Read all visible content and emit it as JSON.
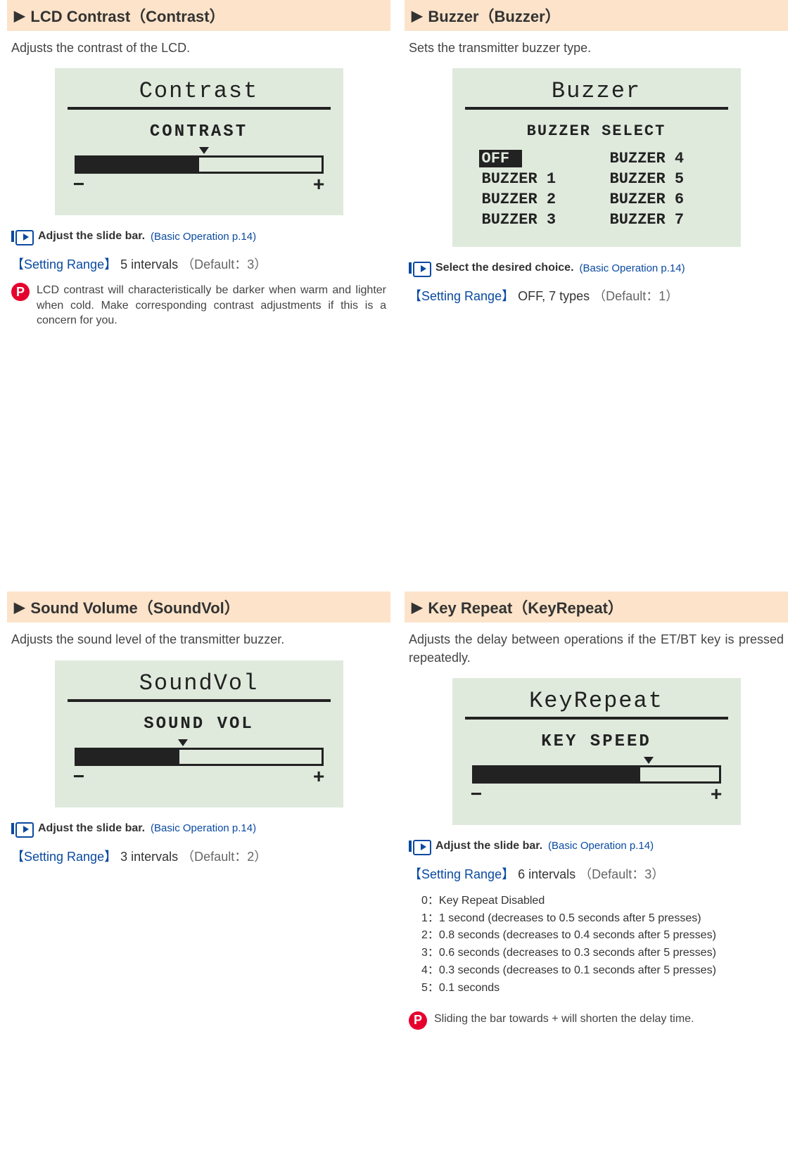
{
  "lcd": {
    "header": "LCD Contrast（Contrast）",
    "desc": "Adjusts the contrast of the LCD.",
    "screen_title": "Contrast",
    "screen_label": "CONTRAST",
    "minus": "−",
    "plus": "+",
    "fill_percent": 50,
    "marker_percent": 52,
    "hint": "Adjust the slide bar.",
    "hint_link": "(Basic Operation p.14)",
    "range_label": "【Setting Range】",
    "range_val": "5 intervals",
    "range_default": "（Default：3）",
    "note": "LCD contrast will characteristically be darker when warm and lighter when cold. Make corresponding contrast adjustments if this is a concern for you."
  },
  "buzzer": {
    "header": "Buzzer（Buzzer）",
    "desc": "Sets the transmitter buzzer type.",
    "screen_title": "Buzzer",
    "sub": "BUZZER SELECT",
    "items": {
      "off": "OFF",
      "b1": "BUZZER 1",
      "b2": "BUZZER 2",
      "b3": "BUZZER 3",
      "b4": "BUZZER 4",
      "b5": "BUZZER 5",
      "b6": "BUZZER 6",
      "b7": "BUZZER 7"
    },
    "hint": "Select the desired choice.",
    "hint_link": "(Basic Operation p.14)",
    "range_label": "【Setting Range】",
    "range_val": "OFF, 7 types",
    "range_default": "（Default：1）"
  },
  "sound": {
    "header": "Sound Volume（SoundVol）",
    "desc": "Adjusts the sound level of the transmitter buzzer.",
    "screen_title": "SoundVol",
    "screen_label": "SOUND VOL",
    "minus": "−",
    "plus": "+",
    "fill_percent": 42,
    "marker_percent": 44,
    "hint": "Adjust the slide bar.",
    "hint_link": "(Basic Operation p.14)",
    "range_label": "【Setting Range】",
    "range_val": "3 intervals",
    "range_default": "（Default：2）"
  },
  "keyrepeat": {
    "header": "Key Repeat（KeyRepeat）",
    "desc": "Adjusts the delay between operations if the ET/BT key is pressed repeatedly.",
    "screen_title": "KeyRepeat",
    "screen_label": "KEY SPEED",
    "minus": "−",
    "plus": "+",
    "fill_percent": 68,
    "marker_percent": 70,
    "hint": "Adjust the slide bar.",
    "hint_link": "(Basic Operation p.14)",
    "range_label": "【Setting Range】",
    "range_val": "6 intervals",
    "range_default": "（Default：3）",
    "list": {
      "l0": "0：Key Repeat Disabled",
      "l1": "1：1 second (decreases to 0.5 seconds after 5 presses)",
      "l2": "2：0.8 seconds (decreases to 0.4 seconds after 5 presses)",
      "l3": "3：0.6 seconds (decreases to 0.3 seconds after 5 presses)",
      "l4": "4：0.3 seconds (decreases to 0.1 seconds after 5 presses)",
      "l5": "5：0.1 seconds"
    },
    "note": "Sliding the bar towards + will shorten the delay time."
  }
}
